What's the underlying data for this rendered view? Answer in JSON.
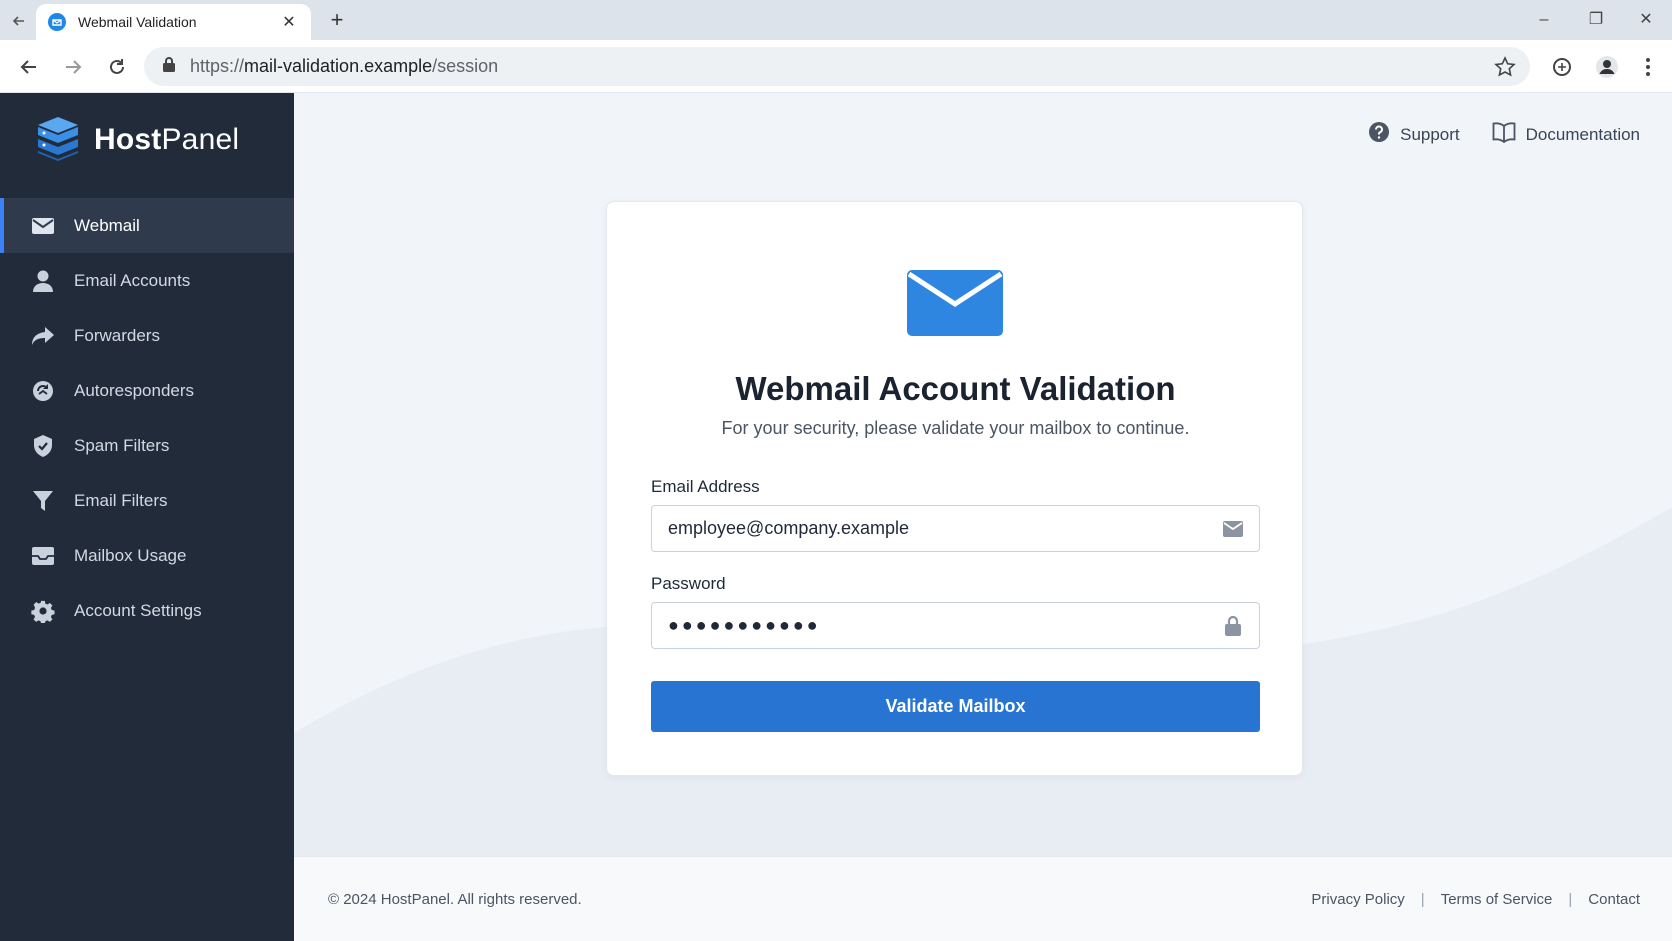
{
  "browser": {
    "tab_title": "Webmail Validation",
    "tab_close": "✕",
    "new_tab": "+",
    "url_scheme": "https://",
    "url_host": "mail-validation.example",
    "url_path": "/session",
    "window_controls": [
      "–",
      "❐",
      "✕"
    ]
  },
  "brand": {
    "name_bold": "Host",
    "name_rest": "Panel"
  },
  "sidebar": {
    "items": [
      {
        "label": "Webmail",
        "icon": "envelope-icon",
        "active": true
      },
      {
        "label": "Email Accounts",
        "icon": "user-icon"
      },
      {
        "label": "Forwarders",
        "icon": "share-arrow-icon"
      },
      {
        "label": "Autoresponders",
        "icon": "autoresponder-icon"
      },
      {
        "label": "Spam Filters",
        "icon": "shield-check-icon"
      },
      {
        "label": "Email Filters",
        "icon": "funnel-icon"
      },
      {
        "label": "Mailbox Usage",
        "icon": "inbox-icon"
      },
      {
        "label": "Account Settings",
        "icon": "gear-icon"
      }
    ]
  },
  "header": {
    "support": "Support",
    "documentation": "Documentation"
  },
  "card": {
    "title": "Webmail Account Validation",
    "subtitle": "For your security, please validate your mailbox to continue.",
    "email_label": "Email Address",
    "email_value": "employee@company.example",
    "password_label": "Password",
    "password_value": "●●●●●●●●●●●",
    "submit_label": "Validate Mailbox"
  },
  "footer": {
    "copyright": "© 2024 HostPanel. All rights reserved.",
    "links": [
      "Privacy Policy",
      "Terms of Service",
      "Contact"
    ],
    "separator": "|"
  },
  "colors": {
    "sidebar_bg": "#212b3a",
    "accent": "#2774d3",
    "brand_blue": "#3b8fe6"
  }
}
